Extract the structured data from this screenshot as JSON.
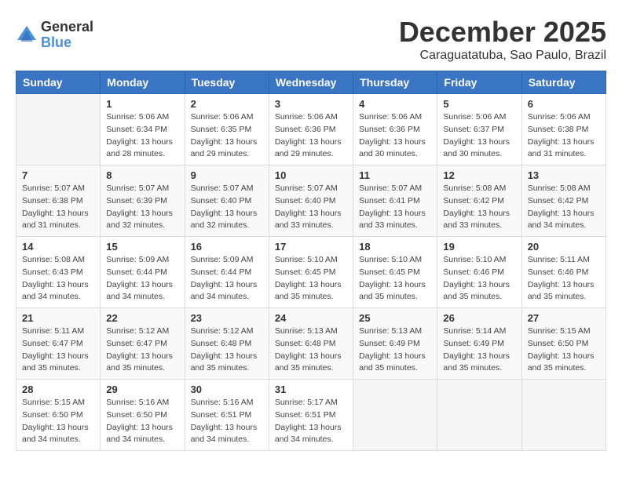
{
  "logo": {
    "general": "General",
    "blue": "Blue"
  },
  "title": "December 2025",
  "location": "Caraguatatuba, Sao Paulo, Brazil",
  "headers": [
    "Sunday",
    "Monday",
    "Tuesday",
    "Wednesday",
    "Thursday",
    "Friday",
    "Saturday"
  ],
  "weeks": [
    [
      {
        "day": "",
        "info": ""
      },
      {
        "day": "1",
        "info": "Sunrise: 5:06 AM\nSunset: 6:34 PM\nDaylight: 13 hours\nand 28 minutes."
      },
      {
        "day": "2",
        "info": "Sunrise: 5:06 AM\nSunset: 6:35 PM\nDaylight: 13 hours\nand 29 minutes."
      },
      {
        "day": "3",
        "info": "Sunrise: 5:06 AM\nSunset: 6:36 PM\nDaylight: 13 hours\nand 29 minutes."
      },
      {
        "day": "4",
        "info": "Sunrise: 5:06 AM\nSunset: 6:36 PM\nDaylight: 13 hours\nand 30 minutes."
      },
      {
        "day": "5",
        "info": "Sunrise: 5:06 AM\nSunset: 6:37 PM\nDaylight: 13 hours\nand 30 minutes."
      },
      {
        "day": "6",
        "info": "Sunrise: 5:06 AM\nSunset: 6:38 PM\nDaylight: 13 hours\nand 31 minutes."
      }
    ],
    [
      {
        "day": "7",
        "info": "Sunrise: 5:07 AM\nSunset: 6:38 PM\nDaylight: 13 hours\nand 31 minutes."
      },
      {
        "day": "8",
        "info": "Sunrise: 5:07 AM\nSunset: 6:39 PM\nDaylight: 13 hours\nand 32 minutes."
      },
      {
        "day": "9",
        "info": "Sunrise: 5:07 AM\nSunset: 6:40 PM\nDaylight: 13 hours\nand 32 minutes."
      },
      {
        "day": "10",
        "info": "Sunrise: 5:07 AM\nSunset: 6:40 PM\nDaylight: 13 hours\nand 33 minutes."
      },
      {
        "day": "11",
        "info": "Sunrise: 5:07 AM\nSunset: 6:41 PM\nDaylight: 13 hours\nand 33 minutes."
      },
      {
        "day": "12",
        "info": "Sunrise: 5:08 AM\nSunset: 6:42 PM\nDaylight: 13 hours\nand 33 minutes."
      },
      {
        "day": "13",
        "info": "Sunrise: 5:08 AM\nSunset: 6:42 PM\nDaylight: 13 hours\nand 34 minutes."
      }
    ],
    [
      {
        "day": "14",
        "info": "Sunrise: 5:08 AM\nSunset: 6:43 PM\nDaylight: 13 hours\nand 34 minutes."
      },
      {
        "day": "15",
        "info": "Sunrise: 5:09 AM\nSunset: 6:44 PM\nDaylight: 13 hours\nand 34 minutes."
      },
      {
        "day": "16",
        "info": "Sunrise: 5:09 AM\nSunset: 6:44 PM\nDaylight: 13 hours\nand 34 minutes."
      },
      {
        "day": "17",
        "info": "Sunrise: 5:10 AM\nSunset: 6:45 PM\nDaylight: 13 hours\nand 35 minutes."
      },
      {
        "day": "18",
        "info": "Sunrise: 5:10 AM\nSunset: 6:45 PM\nDaylight: 13 hours\nand 35 minutes."
      },
      {
        "day": "19",
        "info": "Sunrise: 5:10 AM\nSunset: 6:46 PM\nDaylight: 13 hours\nand 35 minutes."
      },
      {
        "day": "20",
        "info": "Sunrise: 5:11 AM\nSunset: 6:46 PM\nDaylight: 13 hours\nand 35 minutes."
      }
    ],
    [
      {
        "day": "21",
        "info": "Sunrise: 5:11 AM\nSunset: 6:47 PM\nDaylight: 13 hours\nand 35 minutes."
      },
      {
        "day": "22",
        "info": "Sunrise: 5:12 AM\nSunset: 6:47 PM\nDaylight: 13 hours\nand 35 minutes."
      },
      {
        "day": "23",
        "info": "Sunrise: 5:12 AM\nSunset: 6:48 PM\nDaylight: 13 hours\nand 35 minutes."
      },
      {
        "day": "24",
        "info": "Sunrise: 5:13 AM\nSunset: 6:48 PM\nDaylight: 13 hours\nand 35 minutes."
      },
      {
        "day": "25",
        "info": "Sunrise: 5:13 AM\nSunset: 6:49 PM\nDaylight: 13 hours\nand 35 minutes."
      },
      {
        "day": "26",
        "info": "Sunrise: 5:14 AM\nSunset: 6:49 PM\nDaylight: 13 hours\nand 35 minutes."
      },
      {
        "day": "27",
        "info": "Sunrise: 5:15 AM\nSunset: 6:50 PM\nDaylight: 13 hours\nand 35 minutes."
      }
    ],
    [
      {
        "day": "28",
        "info": "Sunrise: 5:15 AM\nSunset: 6:50 PM\nDaylight: 13 hours\nand 34 minutes."
      },
      {
        "day": "29",
        "info": "Sunrise: 5:16 AM\nSunset: 6:50 PM\nDaylight: 13 hours\nand 34 minutes."
      },
      {
        "day": "30",
        "info": "Sunrise: 5:16 AM\nSunset: 6:51 PM\nDaylight: 13 hours\nand 34 minutes."
      },
      {
        "day": "31",
        "info": "Sunrise: 5:17 AM\nSunset: 6:51 PM\nDaylight: 13 hours\nand 34 minutes."
      },
      {
        "day": "",
        "info": ""
      },
      {
        "day": "",
        "info": ""
      },
      {
        "day": "",
        "info": ""
      }
    ]
  ]
}
